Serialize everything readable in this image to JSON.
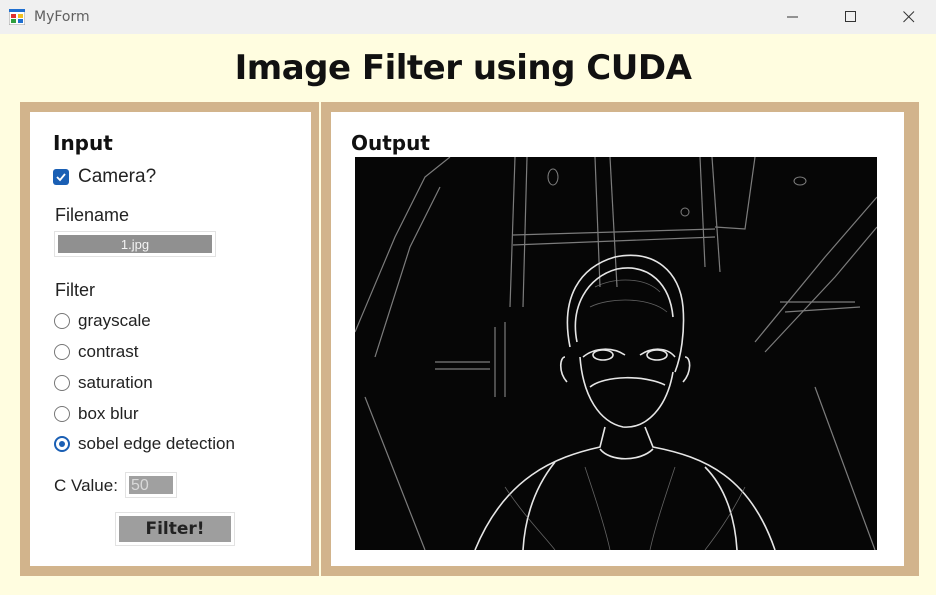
{
  "window": {
    "title": "MyForm",
    "minimize_icon": "minimize-icon",
    "maximize_icon": "maximize-icon",
    "close_icon": "close-icon"
  },
  "heading": "Image Filter using CUDA",
  "input_panel": {
    "title": "Input",
    "camera_label": "Camera?",
    "camera_checked": true,
    "filename_label": "Filename",
    "filename_value": "1.jpg",
    "filter_label": "Filter",
    "filters": [
      {
        "label": "grayscale",
        "selected": false
      },
      {
        "label": "contrast",
        "selected": false
      },
      {
        "label": "saturation",
        "selected": false
      },
      {
        "label": "box blur",
        "selected": false
      },
      {
        "label": "sobel edge detection",
        "selected": true
      }
    ],
    "cvalue_label": "C Value:",
    "cvalue_value": "50",
    "filter_button": "Filter!"
  },
  "output_panel": {
    "title": "Output",
    "image": "sobel-edge-output-image"
  },
  "colors": {
    "form_background": "#fffde0",
    "panel_border": "#d2b48c",
    "accent": "#1a5fb4"
  }
}
